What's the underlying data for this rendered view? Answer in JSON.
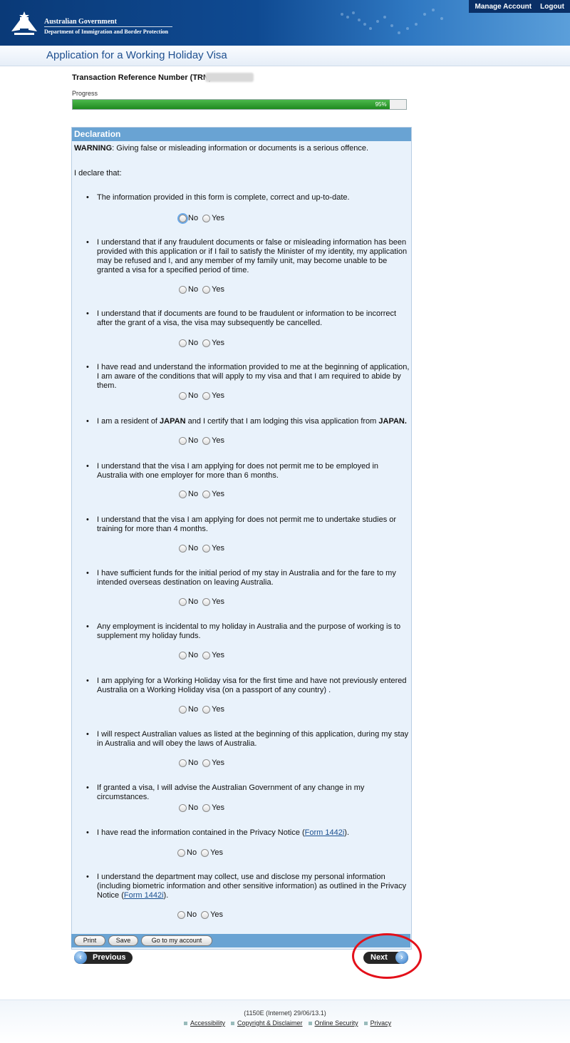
{
  "header": {
    "gov_line1": "Australian Government",
    "gov_line2": "Department of Immigration and Border Protection",
    "links": [
      "Manage Account",
      "Logout"
    ]
  },
  "page_title": "Application for a Working Holiday Visa",
  "trn_label": "Transaction Reference Number (TRN):",
  "progress": {
    "label": "Progress",
    "value_percent": 95,
    "text": "95%"
  },
  "declaration": {
    "header": "Declaration",
    "warning_bold": "WARNING",
    "warning_text": ": Giving false or misleading information or documents is a serious offence.",
    "intro": "I declare that:",
    "radio_no": "No",
    "radio_yes": "Yes",
    "items": [
      {
        "text": "The information provided in this form is complete, correct and up-to-date."
      },
      {
        "text": "I understand that if any fraudulent documents or false or misleading information has been provided with this application or if I fail to satisfy the Minister of my identity, my application may be refused and I, and any member of my family unit, may become unable to be granted a visa for a specified period of time."
      },
      {
        "text": "I understand that if documents are found to be fraudulent or information to be incorrect after the grant of a visa, the visa may subsequently be cancelled."
      },
      {
        "text": "I have read and understand the information provided to me at the beginning of application, I am aware of the conditions that will apply to my visa and that I am required to abide by them."
      },
      {
        "pre": "I am a resident of ",
        "bold1": "JAPAN",
        "mid": " and I certify that I am lodging this visa application from ",
        "bold2": "JAPAN."
      },
      {
        "text": "I understand that the visa I am applying for does not permit me to be employed in Australia with one employer for more than 6 months."
      },
      {
        "text": "I understand that the visa I am applying for does not permit me to undertake studies or training for more than 4 months."
      },
      {
        "text": "I have sufficient funds for the initial period of my stay in Australia and for the fare to my intended overseas destination on leaving Australia."
      },
      {
        "text": "Any employment is incidental to my holiday in Australia and the purpose of working is to supplement my holiday funds."
      },
      {
        "text": "I am applying for a Working Holiday visa for the first time and have not previously entered Australia on a Working Holiday visa (on a passport of any country) ."
      },
      {
        "text": "I will respect Australian values as listed at the beginning of this application, during my stay in Australia and will obey the laws of Australia."
      },
      {
        "text": "If granted a visa, I will advise the Australian Government of any change in my circumstances."
      },
      {
        "pre": "I have read the information contained in the Privacy Notice (",
        "link": "Form 1442i",
        "post": ")."
      },
      {
        "pre": "I understand the department may collect, use and disclose my personal information (including biometric information and other sensitive information) as outlined in the Privacy Notice (",
        "link": "Form 1442i",
        "post": ")."
      }
    ]
  },
  "actions": {
    "print": "Print",
    "save": "Save",
    "account": "Go to my account"
  },
  "nav": {
    "previous": "Previous",
    "next": "Next"
  },
  "footer": {
    "code": "(1150E (Internet) 29/06/13.1)",
    "links": [
      "Accessibility",
      "Copyright & Disclaimer",
      "Online Security",
      "Privacy"
    ]
  },
  "colors": {
    "header_blue": "#0f4a92",
    "panel_blue": "#69a3d3",
    "highlight_red": "#e3101a",
    "progress_green": "#1f8a1f"
  }
}
